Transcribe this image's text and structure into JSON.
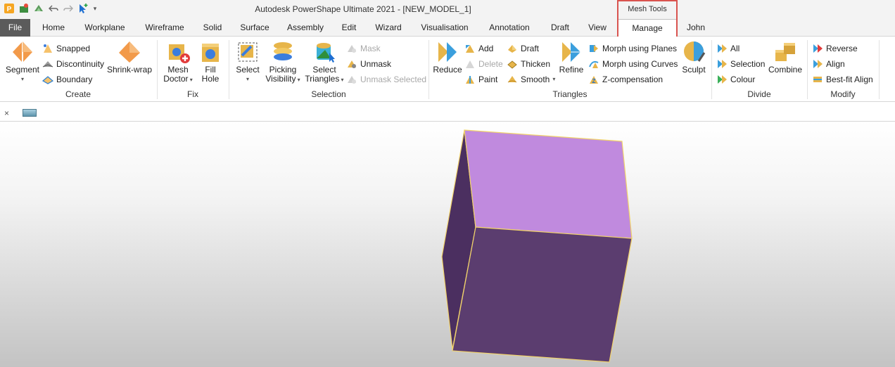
{
  "app": {
    "title": "Autodesk PowerShape Ultimate 2021 - [NEW_MODEL_1]",
    "context_tab_header": "Mesh Tools"
  },
  "qat": {
    "icons": [
      "app-icon",
      "save-icon",
      "model-icon",
      "undo-icon",
      "redo-icon",
      "select-cursor-icon",
      "customize-icon"
    ],
    "customize_caret": "▾"
  },
  "tabs": {
    "file": "File",
    "home": "Home",
    "workplane": "Workplane",
    "wireframe": "Wireframe",
    "solid": "Solid",
    "surface": "Surface",
    "assembly": "Assembly",
    "edit": "Edit",
    "wizard": "Wizard",
    "visualisation": "Visualisation",
    "annotation": "Annotation",
    "draft": "Draft",
    "view": "View",
    "manage": "Manage",
    "user": "John"
  },
  "ribbon": {
    "create": {
      "label": "Create",
      "segment": "Segment",
      "snapped": "Snapped",
      "discontinuity": "Discontinuity",
      "boundary": "Boundary",
      "shrink_wrap": "Shrink-wrap"
    },
    "fix": {
      "label": "Fix",
      "mesh_doctor_1": "Mesh",
      "mesh_doctor_2": "Doctor",
      "fill_hole_1": "Fill",
      "fill_hole_2": "Hole"
    },
    "selection": {
      "label": "Selection",
      "select": "Select",
      "picking_visibility_1": "Picking",
      "picking_visibility_2": "Visibility",
      "select_triangles_1": "Select",
      "select_triangles_2": "Triangles",
      "mask": "Mask",
      "unmask": "Unmask",
      "unmask_selected": "Unmask Selected"
    },
    "triangles": {
      "label": "Triangles",
      "reduce": "Reduce",
      "add": "Add",
      "delete": "Delete",
      "paint": "Paint",
      "draft": "Draft",
      "thicken": "Thicken",
      "smooth": "Smooth",
      "refine": "Refine",
      "morph_planes": "Morph using Planes",
      "morph_curves": "Morph using Curves",
      "z_compensation": "Z-compensation",
      "sculpt": "Sculpt"
    },
    "divide": {
      "label": "Divide",
      "all": "All",
      "selection": "Selection",
      "colour": "Colour",
      "combine": "Combine"
    },
    "modify": {
      "label": "Modify",
      "reverse": "Reverse",
      "align": "Align",
      "best_fit_align": "Best-fit Align"
    }
  },
  "doc": {
    "close_glyph": "×"
  },
  "colors": {
    "accent_file_tab": "#5b5b5b",
    "context_highlight": "#d9534f",
    "cube_top": "#c08ade",
    "cube_front": "#5b3d6f",
    "cube_left": "#4b2f60",
    "cube_edge": "#f1d36b"
  }
}
